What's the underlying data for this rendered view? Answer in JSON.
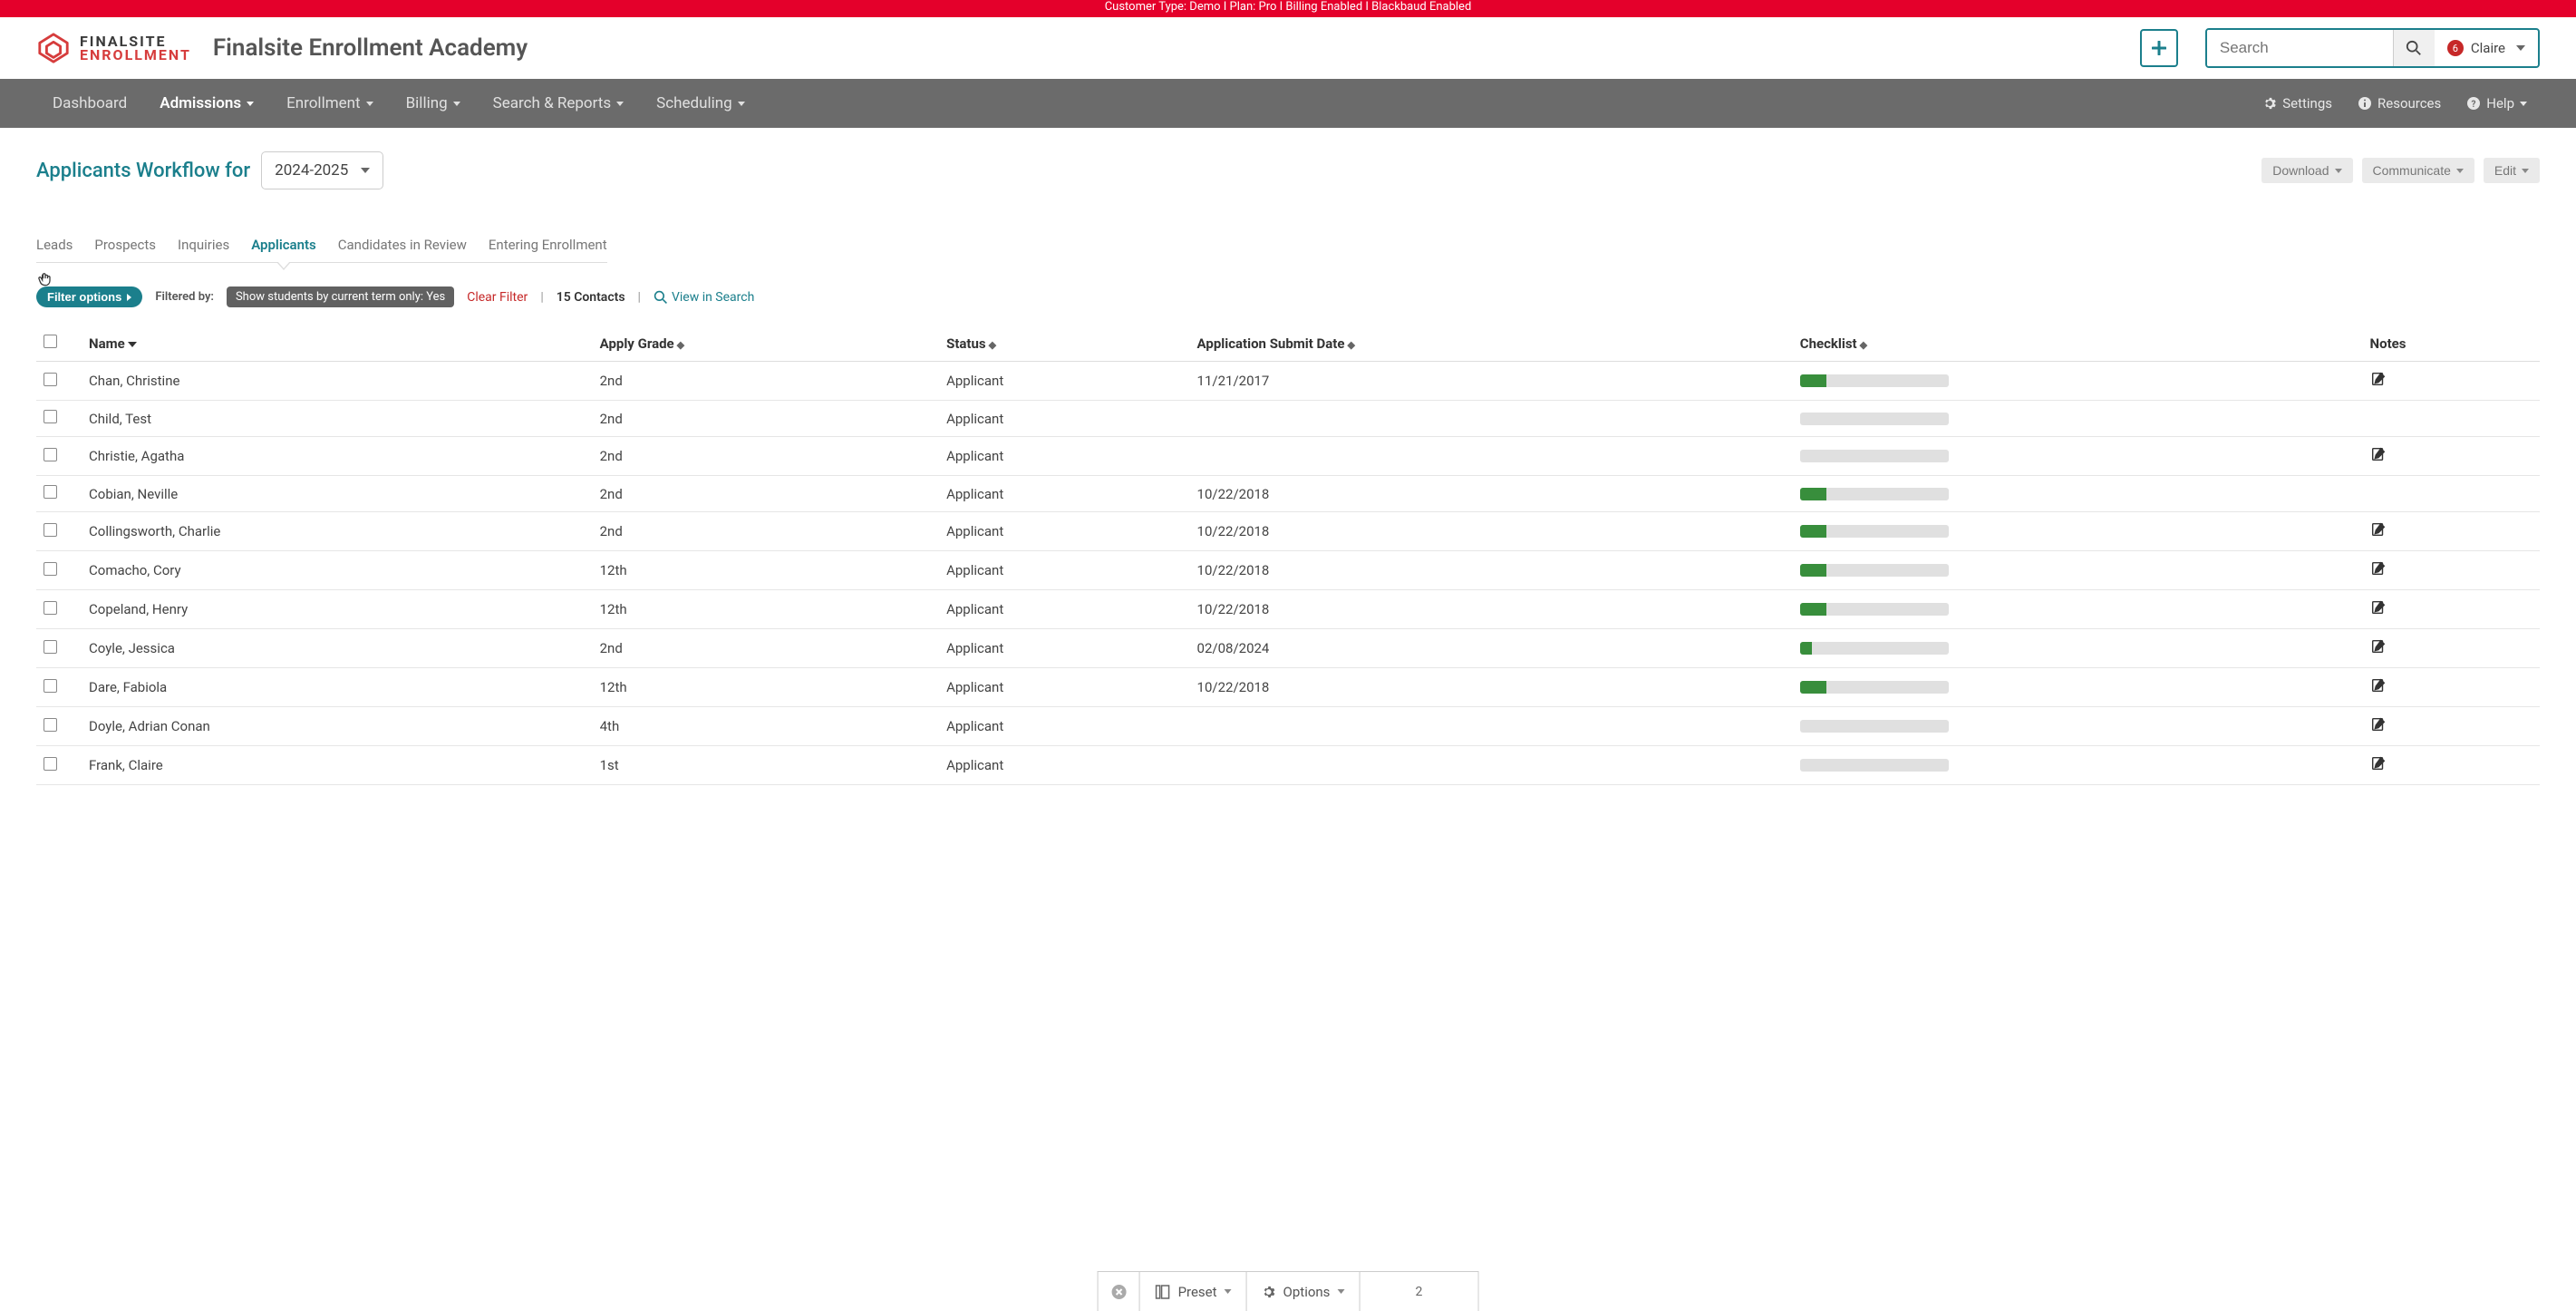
{
  "top_banner": "Customer Type: Demo I Plan: Pro I Billing Enabled I Blackbaud Enabled",
  "logo": {
    "line1": "FINALSITE",
    "line2": "ENROLLMENT"
  },
  "school_title": "Finalsite Enrollment Academy",
  "search": {
    "placeholder": "Search"
  },
  "notif_count": "6",
  "user_name": "Claire",
  "nav": {
    "dashboard": "Dashboard",
    "admissions": "Admissions",
    "enrollment": "Enrollment",
    "billing": "Billing",
    "search_reports": "Search & Reports",
    "scheduling": "Scheduling",
    "settings": "Settings",
    "resources": "Resources",
    "help": "Help"
  },
  "page": {
    "title": "Applicants Workflow for",
    "year": "2024-2025",
    "actions": {
      "download": "Download",
      "communicate": "Communicate",
      "edit": "Edit"
    }
  },
  "tabs": {
    "leads": "Leads",
    "prospects": "Prospects",
    "inquiries": "Inquiries",
    "applicants": "Applicants",
    "candidates": "Candidates in Review",
    "entering": "Entering Enrollment"
  },
  "filters": {
    "button": "Filter options",
    "filtered_by": "Filtered by:",
    "chip": "Show students by current term only: Yes",
    "clear": "Clear Filter",
    "count": "15 Contacts",
    "view_search": "View in Search"
  },
  "columns": {
    "name": "Name",
    "apply_grade": "Apply Grade",
    "status": "Status",
    "submit_date": "Application Submit Date",
    "checklist": "Checklist",
    "notes": "Notes"
  },
  "rows": [
    {
      "name": "Chan, Christine",
      "grade": "2nd",
      "status": "Applicant",
      "date": "11/21/2017",
      "progress": 18,
      "notes": true
    },
    {
      "name": "Child, Test",
      "grade": "2nd",
      "status": "Applicant",
      "date": "",
      "progress": 0,
      "notes": false
    },
    {
      "name": "Christie, Agatha",
      "grade": "2nd",
      "status": "Applicant",
      "date": "",
      "progress": 0,
      "notes": true
    },
    {
      "name": "Cobian, Neville",
      "grade": "2nd",
      "status": "Applicant",
      "date": "10/22/2018",
      "progress": 18,
      "notes": false
    },
    {
      "name": "Collingsworth, Charlie",
      "grade": "2nd",
      "status": "Applicant",
      "date": "10/22/2018",
      "progress": 18,
      "notes": true
    },
    {
      "name": "Comacho, Cory",
      "grade": "12th",
      "status": "Applicant",
      "date": "10/22/2018",
      "progress": 18,
      "notes": true
    },
    {
      "name": "Copeland, Henry",
      "grade": "12th",
      "status": "Applicant",
      "date": "10/22/2018",
      "progress": 18,
      "notes": true
    },
    {
      "name": "Coyle, Jessica",
      "grade": "2nd",
      "status": "Applicant",
      "date": "02/08/2024",
      "progress": 8,
      "notes": true
    },
    {
      "name": "Dare, Fabiola",
      "grade": "12th",
      "status": "Applicant",
      "date": "10/22/2018",
      "progress": 18,
      "notes": true
    },
    {
      "name": "Doyle, Adrian Conan",
      "grade": "4th",
      "status": "Applicant",
      "date": "",
      "progress": 0,
      "notes": true
    },
    {
      "name": "Frank, Claire",
      "grade": "1st",
      "status": "Applicant",
      "date": "",
      "progress": 0,
      "notes": true
    }
  ],
  "footer": {
    "preset": "Preset",
    "options": "Options",
    "page": "2"
  }
}
